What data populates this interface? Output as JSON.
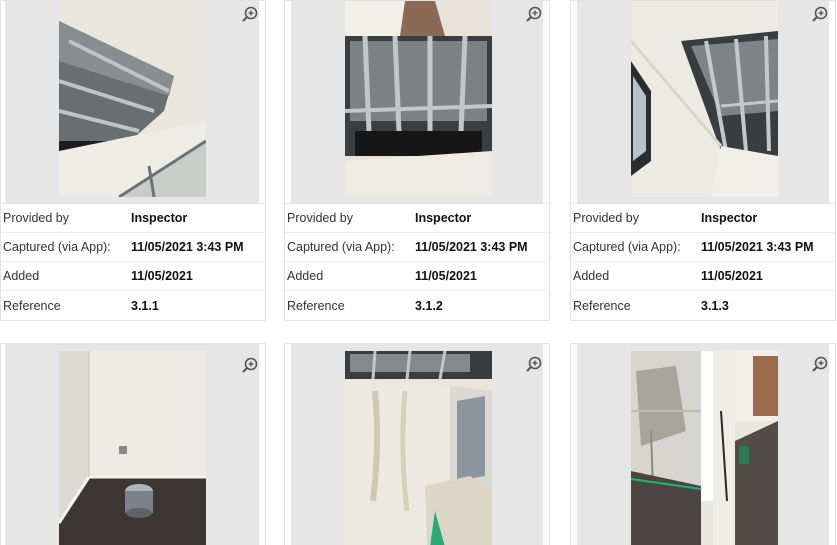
{
  "zoom_icon": "zoom-in-icon",
  "cards": [
    {
      "photo_icon": "ceiling-photo",
      "rows": [
        {
          "label": "Provided by",
          "value": "Inspector"
        },
        {
          "label": "Captured (via App):",
          "value": "11/05/2021 3:43 PM"
        },
        {
          "label": "Added",
          "value": "11/05/2021"
        },
        {
          "label": "Reference",
          "value": "3.1.1"
        }
      ]
    },
    {
      "photo_icon": "ceiling-photo",
      "rows": [
        {
          "label": "Provided by",
          "value": "Inspector"
        },
        {
          "label": "Captured (via App):",
          "value": "11/05/2021 3:43 PM"
        },
        {
          "label": "Added",
          "value": "11/05/2021"
        },
        {
          "label": "Reference",
          "value": "3.1.2"
        }
      ]
    },
    {
      "photo_icon": "ceiling-photo",
      "rows": [
        {
          "label": "Provided by",
          "value": "Inspector"
        },
        {
          "label": "Captured (via App):",
          "value": "11/05/2021 3:43 PM"
        },
        {
          "label": "Added",
          "value": "11/05/2021"
        },
        {
          "label": "Reference",
          "value": "3.1.3"
        }
      ]
    },
    {
      "photo_icon": "room-corner-photo"
    },
    {
      "photo_icon": "room-wall-photo"
    },
    {
      "photo_icon": "doorway-photo"
    }
  ]
}
